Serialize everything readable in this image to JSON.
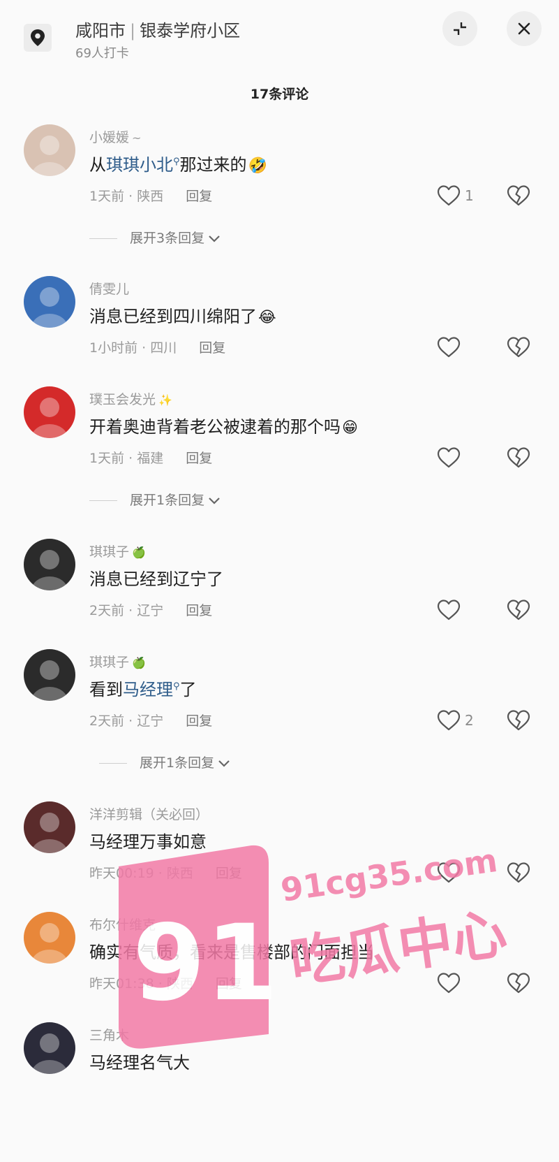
{
  "header": {
    "city": "咸阳市",
    "separator": "|",
    "place": "银泰学府小区",
    "checkins": "69人打卡",
    "icons": [
      "location-pin-icon",
      "collapse-icon",
      "close-icon"
    ]
  },
  "comment_count": "17条评论",
  "comments": [
    {
      "user": "小媛媛",
      "badge": "~",
      "text_before": "从",
      "mention": "琪琪小北",
      "text_after": "那过来的",
      "emoji": "🤣",
      "time": "1天前",
      "region": "陕西",
      "reply": "回复",
      "likes": "1",
      "expand": "展开3条回复",
      "avatar_color": "#d9c2b3"
    },
    {
      "user": "倩雯儿",
      "badge": "",
      "text_before": "消息已经到四川绵阳了",
      "mention": "",
      "text_after": "",
      "emoji": "😂",
      "time": "1小时前",
      "region": "四川",
      "reply": "回复",
      "likes": "",
      "expand": "",
      "avatar_color": "#3a6fb8"
    },
    {
      "user": "璞玉会发光",
      "badge": "✨",
      "text_before": "开着奥迪背着老公被逮着的那个吗",
      "mention": "",
      "text_after": "",
      "emoji": "😁",
      "time": "1天前",
      "region": "福建",
      "reply": "回复",
      "likes": "",
      "expand": "展开1条回复",
      "avatar_color": "#d42a2a"
    },
    {
      "user": "琪琪子",
      "badge": "🍏",
      "text_before": "消息已经到辽宁了",
      "mention": "",
      "text_after": "",
      "emoji": "",
      "time": "2天前",
      "region": "辽宁",
      "reply": "回复",
      "likes": "",
      "expand": "",
      "avatar_color": "#2b2b2b"
    },
    {
      "user": "琪琪子",
      "badge": "🍏",
      "text_before": "看到",
      "mention": "马经理",
      "text_after": "了",
      "emoji": "",
      "time": "2天前",
      "region": "辽宁",
      "reply": "回复",
      "likes": "2",
      "expand": "展开1条回复",
      "avatar_color": "#2b2b2b"
    },
    {
      "user": "洋洋剪辑（关必回）",
      "badge": "",
      "text_before": "马经理万事如意",
      "mention": "",
      "text_after": "",
      "emoji": "",
      "time": "昨天00:19",
      "region": "陕西",
      "reply": "回复",
      "likes": "",
      "expand": "",
      "avatar_color": "#5a2b2b"
    },
    {
      "user": "布尔什维克",
      "badge": "",
      "text_before": "确实有气质，看来是售楼部的门面担当",
      "mention": "",
      "text_after": "",
      "emoji": "",
      "time": "昨天01:38",
      "region": "陕西",
      "reply": "回复",
      "likes": "",
      "expand": "",
      "avatar_color": "#e8873a"
    },
    {
      "user": "三角木",
      "badge": "",
      "text_before": "马经理名气大",
      "mention": "",
      "text_after": "",
      "emoji": "",
      "time": "",
      "region": "",
      "reply": "",
      "likes": "",
      "expand": "",
      "avatar_color": "#2b2b3a"
    }
  ],
  "watermark": {
    "number": "91",
    "site": "91cg35.com",
    "name": "吃瓜中心",
    "color": "#f27aa6"
  }
}
